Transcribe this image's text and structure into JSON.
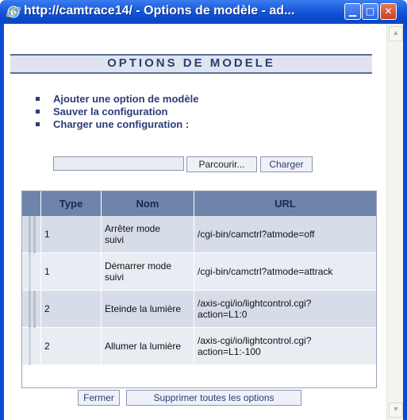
{
  "window": {
    "title": "http://camtrace14/ - Options de modèle - ad...",
    "min_glyph": "▁",
    "max_glyph": "□",
    "close_glyph": "✕"
  },
  "page": {
    "heading": "OPTIONS DE MODELE",
    "links": [
      {
        "label": "Ajouter une option de modèle"
      },
      {
        "label": "Sauver la configuration"
      },
      {
        "label": "Charger une configuration :"
      }
    ],
    "upload": {
      "browse_label": "Parcourir...",
      "load_label": "Charger"
    }
  },
  "table": {
    "columns": [
      "Type",
      "Nom",
      "URL"
    ],
    "rows": [
      {
        "type": "1",
        "name": "Arrêter mode suivi",
        "url": "/cgi-bin/camctrl?atmode=off"
      },
      {
        "type": "1",
        "name": "Démarrer mode suivi",
        "url": "/cgi-bin/camctrl?atmode=attrack"
      },
      {
        "type": "2",
        "name": "Eteinde la lumière",
        "url": "/axis-cgi/io/lightcontrol.cgi?action=L1:0"
      },
      {
        "type": "2",
        "name": "Allumer la lumière",
        "url": "/axis-cgi/io/lightcontrol.cgi?action=L1:-100"
      }
    ]
  },
  "footer": {
    "close_label": "Fermer",
    "delete_all_label": "Supprimer toutes les options"
  },
  "colors": {
    "title_bar": "#0a4bd0",
    "header_text": "#2c3c78",
    "table_header": "#6f84aa",
    "row_light": "#d7dde8",
    "row_alt": "#e9ecf2"
  },
  "icons": {
    "browser": "ie-icon",
    "scroll_up": "scroll-up-arrow-icon",
    "scroll_down": "scroll-down-arrow-icon"
  }
}
